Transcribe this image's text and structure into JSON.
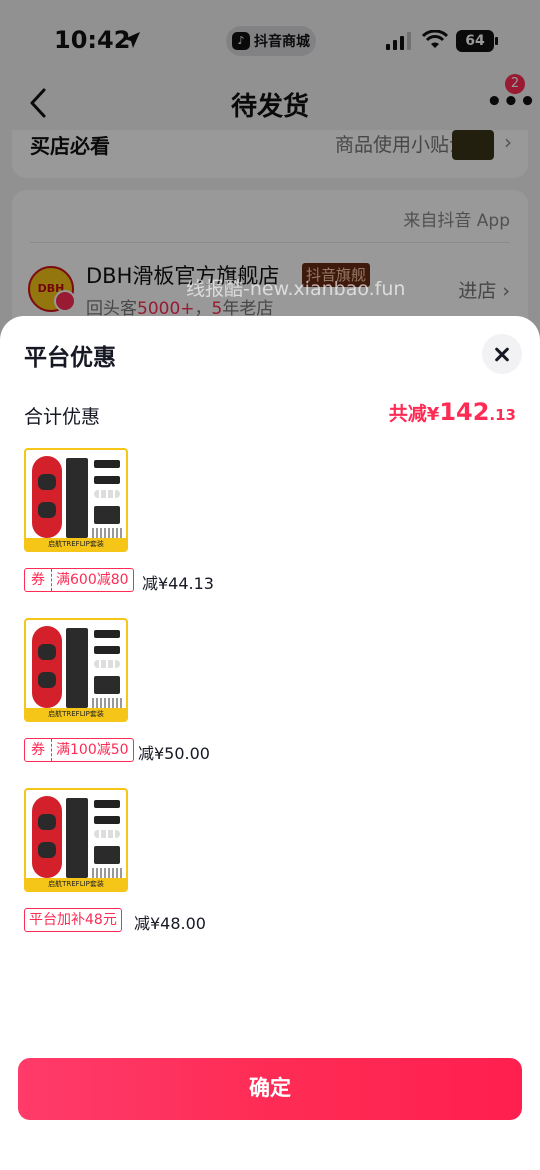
{
  "status_bar": {
    "time": "10:42",
    "app_name": "抖音商城",
    "battery": "64"
  },
  "nav": {
    "title": "待发货",
    "badge": "2"
  },
  "bg_card1": {
    "left": "买店必看",
    "right": "商品使用小贴士"
  },
  "store": {
    "source": "来自抖音 App",
    "logo_text": "DBH",
    "name": "DBH滑板官方旗舰店",
    "tag": "抖音旗舰",
    "sub_prefix": "回头客",
    "sub_count": "5000+",
    "sub_sep": "，",
    "sub_years": "5",
    "sub_suffix": "年老店",
    "enter": "进店 ›"
  },
  "watermark": "线报酷-new.xianbao.fun",
  "sheet": {
    "title": "平台优惠",
    "total_label": "合计优惠",
    "total_prefix": "共减",
    "total_currency": "¥",
    "total_int": "142",
    "total_dec": ".13",
    "items": [
      {
        "product_band": "启航TREFLIP套装",
        "coupon_key": "券",
        "coupon_value": "满600减80",
        "saving": "减¥44.13"
      },
      {
        "product_band": "启航TREFLIP套装",
        "coupon_key": "券",
        "coupon_value": "满100减50",
        "saving": "减¥50.00"
      },
      {
        "product_band": "启航TREFLIP套装",
        "coupon_value": "平台加补48元",
        "saving": "减¥48.00"
      }
    ],
    "confirm": "确定"
  },
  "colors": {
    "accent": "#fe2c55",
    "brand_yellow": "#f5c518"
  }
}
